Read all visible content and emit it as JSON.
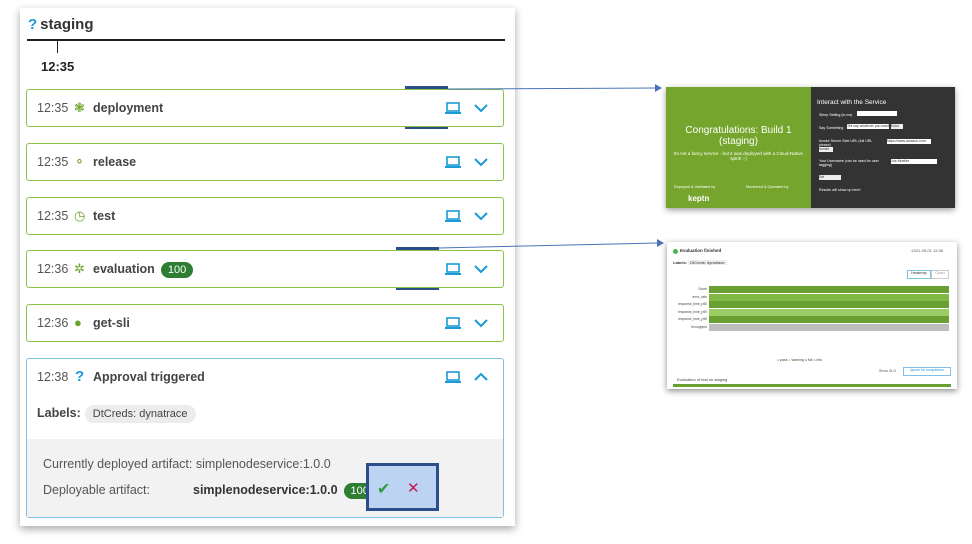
{
  "stage": {
    "title": "staging",
    "time": "12:35"
  },
  "events": [
    {
      "time": "12:35",
      "name": "deployment",
      "icon": "deployment-icon"
    },
    {
      "time": "12:35",
      "name": "release",
      "icon": "release-icon"
    },
    {
      "time": "12:35",
      "name": "test",
      "icon": "test-icon"
    },
    {
      "time": "12:36",
      "name": "evaluation",
      "icon": "evaluation-icon",
      "badge": "100"
    },
    {
      "time": "12:36",
      "name": "get-sli",
      "icon": "info-icon"
    }
  ],
  "approval": {
    "time": "12:38",
    "name": "Approval triggered",
    "labels_title": "Labels:",
    "label_chip": "DtCreds: dynatrace",
    "current_label": "Currently deployed artifact: simplenodeservice:1.0.0",
    "deployable_label": "Deployable artifact:",
    "deployable_value": "simplenodeservice:1.0.0",
    "score": "100"
  },
  "preview_app": {
    "congrats": "Congratulations: Build 1",
    "stage": "(staging)",
    "fancy": "Its not a fancy service - but it was deployed with a Cloud-Native spirit! :-)",
    "deployed_by": "Deployed & Validated by",
    "monitored_by": "Monitored & Operated by",
    "keptn": "keptn",
    "panel_title": "Interact with the Service",
    "sleep_label": "Sleep Setting (in ms)",
    "say_label": "Say Something",
    "say_value": "Tell say whatever you want",
    "echo_btn": "Echo",
    "invoke_label": "Invoke Server Side URL (full URL please)",
    "invoke_value": "https://www.amazon.com",
    "invoke_btn": "Invoke",
    "user_label": "Your Username (can be used for user tagging)",
    "user_value": "Joe Mueller",
    "user_btn": "Set Username",
    "result": "Results will show up here!"
  },
  "preview_eval": {
    "title": "Evaluation finished",
    "date": "2021-05-01 12:38",
    "labels": "Labels:",
    "chip": "DtCreds: dynatrace",
    "tab_heatmap": "Heatmap",
    "tab_chart": "Chart",
    "rows": [
      "Score",
      "error_rate",
      "response_time_p50",
      "response_time_p90",
      "response_time_p95",
      "throughput"
    ],
    "legend": [
      "pass",
      "warning",
      "fail",
      "info"
    ],
    "show_sli": "Show SLO",
    "ignore": "Ignore for comparison",
    "footer": "Evaluation of test on staging"
  }
}
